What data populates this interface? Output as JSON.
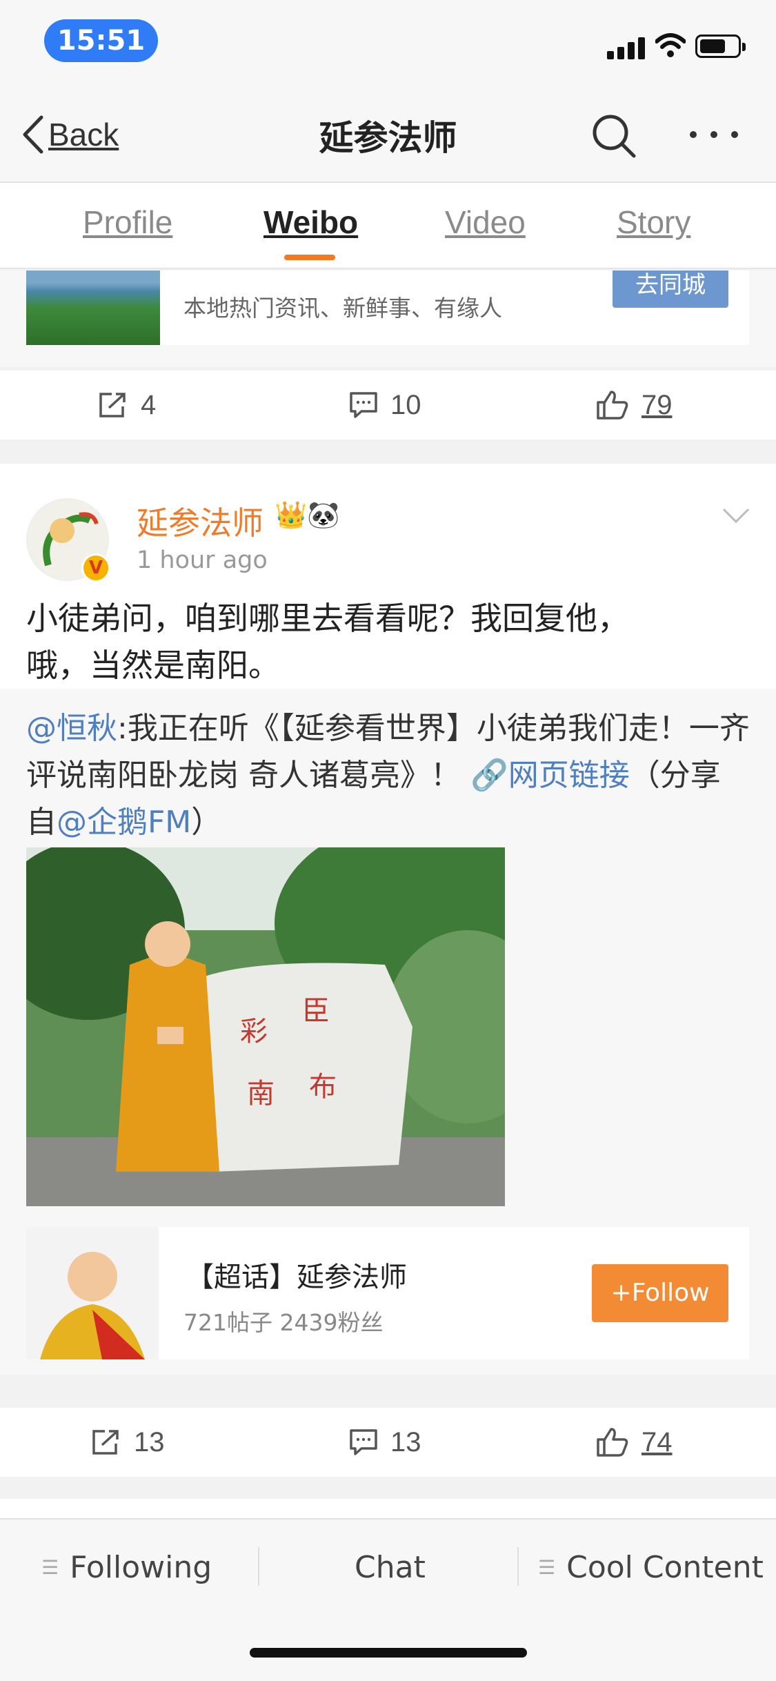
{
  "status": {
    "time": "15:51"
  },
  "nav": {
    "back_label": "Back",
    "title": "延参法师"
  },
  "tabs": [
    {
      "label": "Profile"
    },
    {
      "label": "Weibo"
    },
    {
      "label": "Video"
    },
    {
      "label": "Story"
    }
  ],
  "prev_post": {
    "city_card": {
      "description": "本地热门资讯、新鲜事、有缘人",
      "button": "去同城"
    },
    "actions": {
      "reposts": "4",
      "comments": "10",
      "likes": "79"
    }
  },
  "post": {
    "author": "延参法师",
    "verified_badge": "V",
    "badges": "👑🐼",
    "time": "1 hour ago",
    "text_line1": "小徒弟问，咱到哪里去看看呢？我回复他，",
    "text_line2": "哦，当然是南阳。",
    "repost": {
      "mention": "@恒秋",
      "text": ":我正在听《【延参看世界】小徒弟我们走！一齐评说南阳卧龙岗 奇人诸葛亮》！",
      "link_label": "🔗网页链接",
      "share_prefix": "（分享自",
      "share_mention": "@企鹅FM",
      "share_suffix": "）"
    },
    "super_topic": {
      "title": "【超话】延参法师",
      "stats": "721帖子 2439粉丝",
      "follow_label": "+Follow"
    },
    "actions": {
      "reposts": "13",
      "comments": "13",
      "likes": "74"
    }
  },
  "bottom_tabs": [
    {
      "label": "Following"
    },
    {
      "label": "Chat"
    },
    {
      "label": "Cool Content"
    }
  ],
  "colors": {
    "accent": "#f07b2b",
    "link": "#4f7fbf",
    "time_pill": "#2f7cf6"
  }
}
